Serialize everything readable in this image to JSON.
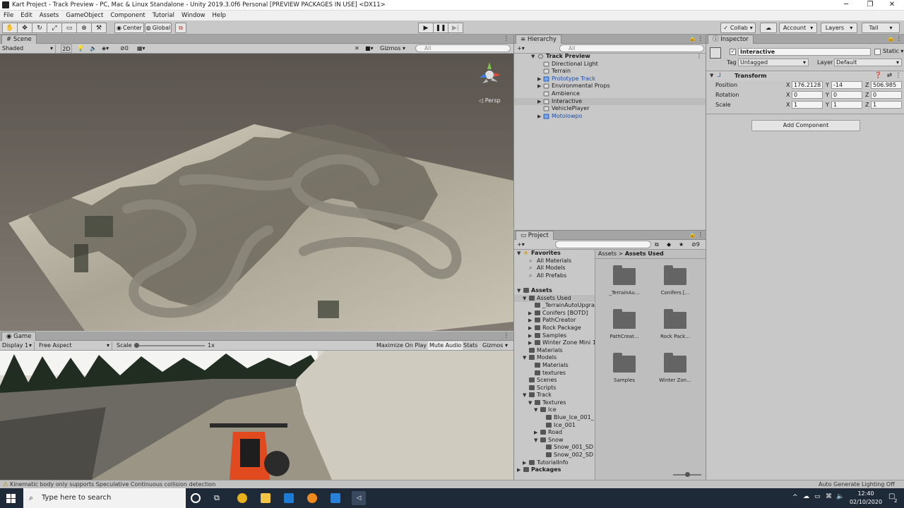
{
  "window": {
    "title": "Kart Project - Track Preview - PC, Mac & Linux Standalone - Unity 2019.3.0f6 Personal [PREVIEW PACKAGES IN USE] <DX11>",
    "minimize": "─",
    "maximize": "❐",
    "close": "✕"
  },
  "menu": [
    "File",
    "Edit",
    "Assets",
    "GameObject",
    "Component",
    "Tutorial",
    "Window",
    "Help"
  ],
  "toolbar": {
    "center": "Center",
    "global": "Global",
    "collab": "Collab",
    "account": "Account",
    "layers": "Layers",
    "layout": "Tall"
  },
  "scene": {
    "tab": "Scene",
    "shading": "Shaded",
    "mode2d": "2D",
    "hidden_count": "0",
    "gizmos": "Gizmos",
    "search": "All",
    "persp": "Persp"
  },
  "game": {
    "tab": "Game",
    "display": "Display 1",
    "aspect": "Free Aspect",
    "scale_label": "Scale",
    "scale_value": "1x",
    "maximize": "Maximize On Play",
    "mute": "Mute Audio",
    "stats": "Stats",
    "gizmos": "Gizmos"
  },
  "hierarchy": {
    "tab": "Hierarchy",
    "search": "All",
    "root": "Track Preview",
    "items": [
      {
        "label": "Directional Light",
        "prefab": false,
        "expandable": false,
        "selected": false
      },
      {
        "label": "Terrain",
        "prefab": false,
        "expandable": false,
        "selected": false
      },
      {
        "label": "Prototype Track",
        "prefab": true,
        "expandable": true,
        "selected": false
      },
      {
        "label": "Environmental Props",
        "prefab": false,
        "expandable": true,
        "selected": false
      },
      {
        "label": "Ambience",
        "prefab": false,
        "expandable": false,
        "selected": false
      },
      {
        "label": "Interactive",
        "prefab": false,
        "expandable": true,
        "selected": true
      },
      {
        "label": "VehiclePlayer",
        "prefab": false,
        "expandable": false,
        "selected": false
      },
      {
        "label": "Motolowpo",
        "prefab": true,
        "expandable": true,
        "selected": false
      }
    ]
  },
  "inspector": {
    "tab": "Inspector",
    "name": "Interactive",
    "static": "Static",
    "tag_label": "Tag",
    "tag": "Untagged",
    "layer_label": "Layer",
    "layer": "Default",
    "component": "Transform",
    "rows": [
      {
        "label": "Position",
        "x": "176.2128",
        "y": "-14",
        "z": "506.985"
      },
      {
        "label": "Rotation",
        "x": "0",
        "y": "0",
        "z": "0"
      },
      {
        "label": "Scale",
        "x": "1",
        "y": "1",
        "z": "1"
      }
    ],
    "add_component": "Add Component"
  },
  "project": {
    "tab": "Project",
    "hidden_count": "9",
    "breadcrumb_root": "Assets",
    "breadcrumb_current": "Assets Used",
    "tree": [
      {
        "label": "Favorites",
        "depth": 0,
        "arrow": "▼",
        "kind": "star",
        "bold": true
      },
      {
        "label": "All Materials",
        "depth": 1,
        "arrow": "",
        "kind": "search",
        "bold": false
      },
      {
        "label": "All Models",
        "depth": 1,
        "arrow": "",
        "kind": "search",
        "bold": false
      },
      {
        "label": "All Prefabs",
        "depth": 1,
        "arrow": "",
        "kind": "search",
        "bold": false
      },
      {
        "label": "",
        "depth": 0,
        "arrow": "",
        "kind": "none",
        "bold": false
      },
      {
        "label": "Assets",
        "depth": 0,
        "arrow": "▼",
        "kind": "folder",
        "bold": true
      },
      {
        "label": "Assets Used",
        "depth": 1,
        "arrow": "▼",
        "kind": "folder",
        "bold": false,
        "selected": true
      },
      {
        "label": "_TerrainAutoUpgrac",
        "depth": 2,
        "arrow": "",
        "kind": "folder",
        "bold": false
      },
      {
        "label": "Conifers [BOTD]",
        "depth": 2,
        "arrow": "▶",
        "kind": "folder",
        "bold": false
      },
      {
        "label": "PathCreator",
        "depth": 2,
        "arrow": "▶",
        "kind": "folder",
        "bold": false
      },
      {
        "label": "Rock Package",
        "depth": 2,
        "arrow": "▶",
        "kind": "folder",
        "bold": false
      },
      {
        "label": "Samples",
        "depth": 2,
        "arrow": "▶",
        "kind": "folder",
        "bold": false
      },
      {
        "label": "Winter Zone Mini 1.",
        "depth": 2,
        "arrow": "▶",
        "kind": "folder",
        "bold": false
      },
      {
        "label": "Materials",
        "depth": 1,
        "arrow": "",
        "kind": "folder",
        "bold": false
      },
      {
        "label": "Models",
        "depth": 1,
        "arrow": "▼",
        "kind": "folder",
        "bold": false
      },
      {
        "label": "Materials",
        "depth": 2,
        "arrow": "",
        "kind": "folder",
        "bold": false
      },
      {
        "label": "textures",
        "depth": 2,
        "arrow": "",
        "kind": "folder",
        "bold": false
      },
      {
        "label": "Scenes",
        "depth": 1,
        "arrow": "",
        "kind": "folder",
        "bold": false
      },
      {
        "label": "Scripts",
        "depth": 1,
        "arrow": "",
        "kind": "folder",
        "bold": false
      },
      {
        "label": "Track",
        "depth": 1,
        "arrow": "▼",
        "kind": "folder",
        "bold": false
      },
      {
        "label": "Textures",
        "depth": 2,
        "arrow": "▼",
        "kind": "folder",
        "bold": false
      },
      {
        "label": "Ice",
        "depth": 3,
        "arrow": "▼",
        "kind": "folder",
        "bold": false
      },
      {
        "label": "Blue_Ice_001_",
        "depth": 4,
        "arrow": "",
        "kind": "folder",
        "bold": false
      },
      {
        "label": "Ice_001",
        "depth": 4,
        "arrow": "",
        "kind": "folder",
        "bold": false
      },
      {
        "label": "Road",
        "depth": 3,
        "arrow": "▶",
        "kind": "folder",
        "bold": false
      },
      {
        "label": "Snow",
        "depth": 3,
        "arrow": "▼",
        "kind": "folder",
        "bold": false
      },
      {
        "label": "Snow_001_SD",
        "depth": 4,
        "arrow": "",
        "kind": "folder",
        "bold": false
      },
      {
        "label": "Snow_002_SD",
        "depth": 4,
        "arrow": "",
        "kind": "folder",
        "bold": false
      },
      {
        "label": "TutorialInfo",
        "depth": 1,
        "arrow": "▶",
        "kind": "folder",
        "bold": false
      },
      {
        "label": "Packages",
        "depth": 0,
        "arrow": "▶",
        "kind": "folder",
        "bold": true
      }
    ],
    "grid": [
      "_TerrainAu...",
      "Conifers [...",
      "PathCreat...",
      "Rock Pack...",
      "Samples",
      "Winter Zon..."
    ]
  },
  "status": {
    "message": "Kinematic body only supports Speculative Continuous collision detection",
    "lighting": "Auto Generate Lighting Off"
  },
  "taskbar": {
    "search": "Type here to search",
    "time": "12:40",
    "date": "02/10/2020",
    "notifications": "2"
  },
  "colors": {
    "prefab_blue": "#1a4fb0",
    "selection": "#bcbcbc",
    "sky": "#5f5953"
  }
}
